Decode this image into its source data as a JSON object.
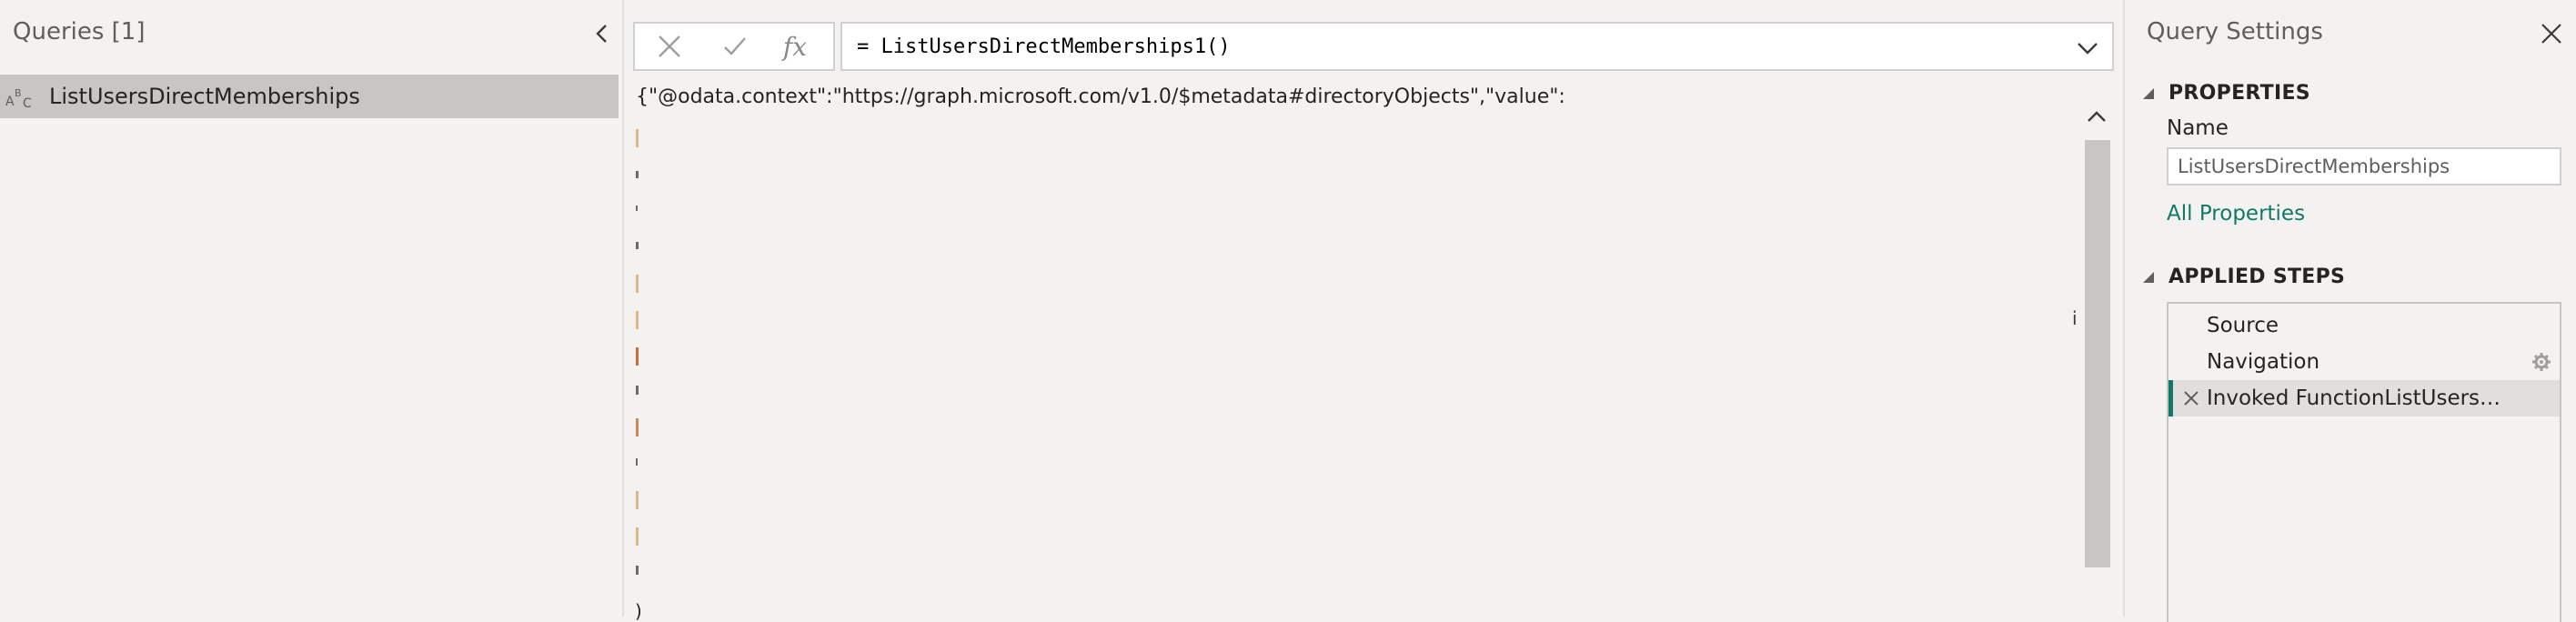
{
  "queries_pane": {
    "title": "Queries [1]",
    "items": [
      {
        "label": "ListUsersDirectMemberships",
        "type_icon": "text-type-icon"
      }
    ]
  },
  "formula": {
    "cancel_icon": "cancel-x-icon",
    "commit_icon": "checkmark-icon",
    "fx_label": "fx",
    "text": "= ListUsersDirectMemberships1()"
  },
  "preview": {
    "first_line": "{\"@odata.context\":\"https://graph.microsoft.com/v1.0/$metadata#directoryObjects\",\"value\":",
    "stray_i": "i",
    "stray_brace": ")"
  },
  "settings": {
    "title": "Query Settings",
    "properties_header": "PROPERTIES",
    "name_label": "Name",
    "name_value": "ListUsersDirectMemberships",
    "all_properties_link": "All Properties",
    "applied_steps_header": "APPLIED STEPS",
    "steps": [
      {
        "label": "Source",
        "active": false,
        "gear": false
      },
      {
        "label": "Navigation",
        "active": false,
        "gear": true
      },
      {
        "label": "Invoked FunctionListUsersDir...",
        "active": true,
        "gear": false
      }
    ]
  },
  "colors": {
    "accent": "#117865",
    "selected_bg": "#c8c6c4",
    "pane_bg": "#f3f2f1"
  }
}
